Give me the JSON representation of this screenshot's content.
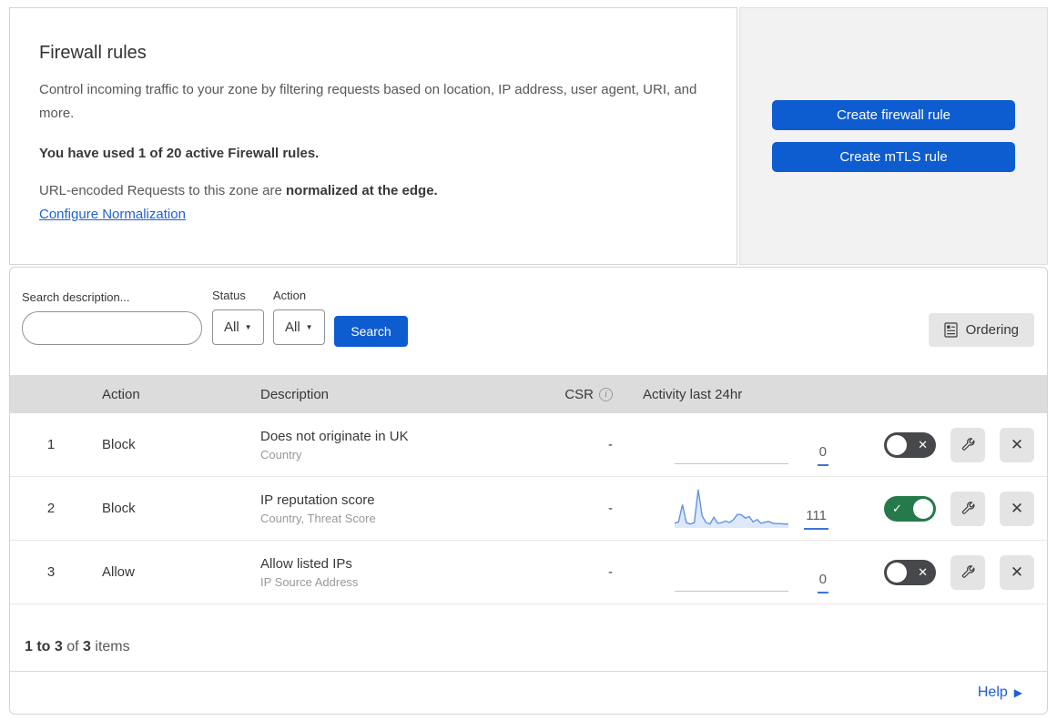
{
  "header": {
    "title": "Firewall rules",
    "description": "Control incoming traffic to your zone by filtering requests based on location, IP address, user agent, URI, and more.",
    "usage_notice": "You have used 1 of 20 active Firewall rules.",
    "normalization_text": "URL-encoded Requests to this zone are ",
    "normalization_bold": "normalized at the edge.",
    "normalization_link": "Configure Normalization",
    "buttons": {
      "create_firewall": "Create firewall rule",
      "create_mtls": "Create mTLS rule"
    }
  },
  "filters": {
    "search_label": "Search description...",
    "search_value": "",
    "status_label": "Status",
    "status_value": "All",
    "action_label": "Action",
    "action_value": "All",
    "search_button": "Search",
    "ordering_button": "Ordering"
  },
  "table": {
    "columns": {
      "action": "Action",
      "description": "Description",
      "csr": "CSR",
      "activity": "Activity last 24hr"
    },
    "rows": [
      {
        "num": "1",
        "action": "Block",
        "description": "Does not originate in UK",
        "fields": "Country",
        "csr": "-",
        "activity_count": "0",
        "enabled": false
      },
      {
        "num": "2",
        "action": "Block",
        "description": "IP reputation score",
        "fields": "Country, Threat Score",
        "csr": "-",
        "activity_count": "111",
        "enabled": true
      },
      {
        "num": "3",
        "action": "Allow",
        "description": "Allow listed IPs",
        "fields": "IP Source Address",
        "csr": "-",
        "activity_count": "0",
        "enabled": false
      }
    ],
    "sparkline": {
      "values": [
        10,
        14,
        60,
        12,
        8,
        12,
        100,
        30,
        12,
        8,
        26,
        10,
        12,
        16,
        12,
        20,
        34,
        33,
        24,
        28,
        14,
        20,
        10,
        13,
        15,
        10,
        9,
        9,
        8,
        8
      ],
      "line_color": "#6592dd",
      "fill_color": "#dde8f8"
    }
  },
  "footer": {
    "summary_range": "1 to 3",
    "summary_of": " of ",
    "summary_total": "3",
    "summary_items": " items",
    "help_label": "Help"
  },
  "icons": {
    "dropdown_caret": "▼",
    "info": "i",
    "toggle_off_x": "✕",
    "toggle_on_check": "✓",
    "close_x": "✕",
    "help_arrow": "▶"
  },
  "colors": {
    "primary_blue": "#0d5cd0",
    "link_blue": "#2161d3",
    "toggle_on_green": "#26794b",
    "toggle_off_gray": "#46484b",
    "table_header_bg": "#dcdcdc",
    "panel_bg": "#f2f2f2"
  }
}
